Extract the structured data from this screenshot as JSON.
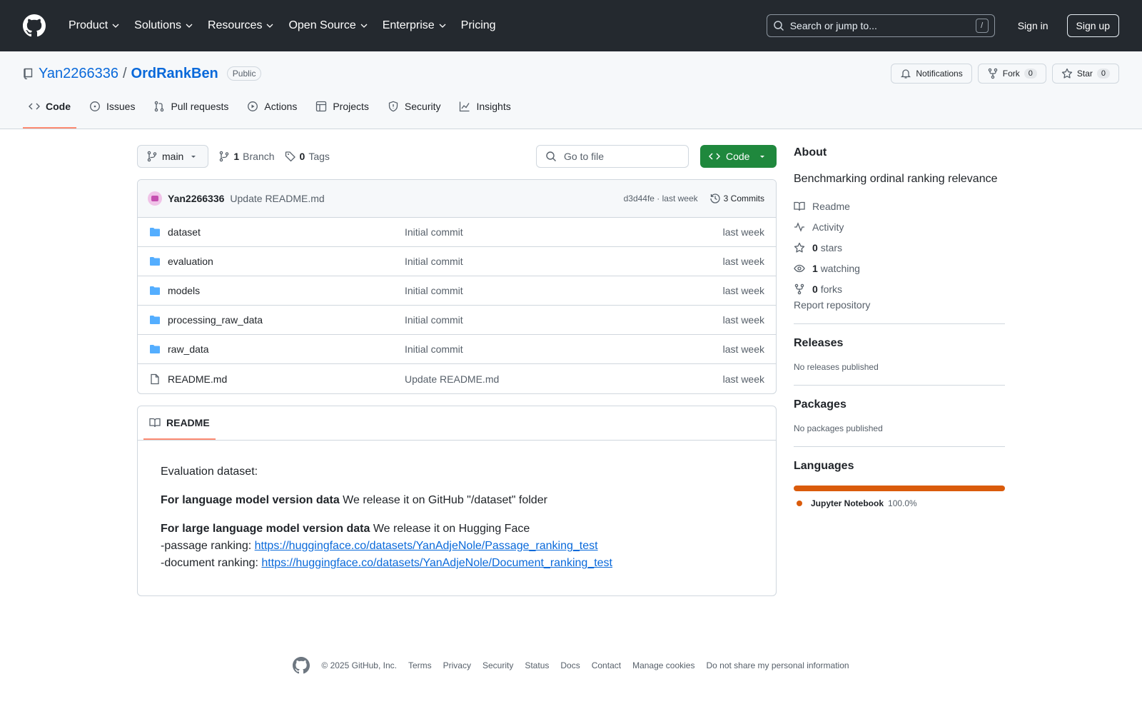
{
  "header": {
    "nav": [
      "Product",
      "Solutions",
      "Resources",
      "Open Source",
      "Enterprise",
      "Pricing"
    ],
    "search_placeholder": "Search or jump to...",
    "search_shortcut": "/",
    "sign_in": "Sign in",
    "sign_up": "Sign up"
  },
  "repo": {
    "owner": "Yan2266336",
    "separator": "/",
    "name": "OrdRankBen",
    "visibility": "Public",
    "notifications_label": "Notifications",
    "fork_label": "Fork",
    "fork_count": "0",
    "star_label": "Star",
    "star_count": "0"
  },
  "tabs": [
    {
      "label": "Code",
      "icon": "code-icon"
    },
    {
      "label": "Issues",
      "icon": "issue-icon"
    },
    {
      "label": "Pull requests",
      "icon": "pull-request-icon"
    },
    {
      "label": "Actions",
      "icon": "play-icon"
    },
    {
      "label": "Projects",
      "icon": "table-icon"
    },
    {
      "label": "Security",
      "icon": "shield-icon"
    },
    {
      "label": "Insights",
      "icon": "graph-icon"
    }
  ],
  "toolbar": {
    "branch": "main",
    "branch_count": "1",
    "branch_label": "Branch",
    "tag_count": "0",
    "tag_label": "Tags",
    "goto_placeholder": "Go to file",
    "code_label": "Code"
  },
  "commit": {
    "author": "Yan2266336",
    "message": "Update README.md",
    "hash_time": "d3d44fe · last week",
    "commits_label": "3 Commits"
  },
  "files": [
    {
      "name": "dataset",
      "type": "dir",
      "commit": "Initial commit",
      "time": "last week"
    },
    {
      "name": "evaluation",
      "type": "dir",
      "commit": "Initial commit",
      "time": "last week"
    },
    {
      "name": "models",
      "type": "dir",
      "commit": "Initial commit",
      "time": "last week"
    },
    {
      "name": "processing_raw_data",
      "type": "dir",
      "commit": "Initial commit",
      "time": "last week"
    },
    {
      "name": "raw_data",
      "type": "dir",
      "commit": "Initial commit",
      "time": "last week"
    },
    {
      "name": "README.md",
      "type": "file",
      "commit": "Update README.md",
      "time": "last week"
    }
  ],
  "readme": {
    "tab_label": "README",
    "line1": "Evaluation dataset:",
    "lm_bold": "For language model version data",
    "lm_text": " We release it on GitHub \"/dataset\" folder",
    "llm_bold": "For large language model version data",
    "llm_text": " We release it on Hugging Face",
    "passage_prefix": "-passage ranking: ",
    "passage_link": "https://huggingface.co/datasets/YanAdjeNole/Passage_ranking_test",
    "document_prefix": "-document ranking: ",
    "document_link": "https://huggingface.co/datasets/YanAdjeNole/Document_ranking_test"
  },
  "about": {
    "title": "About",
    "description": "Benchmarking ordinal ranking relevance",
    "readme": "Readme",
    "activity": "Activity",
    "stars_count": "0",
    "stars_label": "stars",
    "watching_count": "1",
    "watching_label": "watching",
    "forks_count": "0",
    "forks_label": "forks",
    "report": "Report repository"
  },
  "releases": {
    "title": "Releases",
    "text": "No releases published"
  },
  "packages": {
    "title": "Packages",
    "text": "No packages published"
  },
  "languages": {
    "title": "Languages",
    "name": "Jupyter Notebook",
    "percent": "100.0%",
    "color": "#da5b0b"
  },
  "footer": {
    "copyright": "© 2025 GitHub, Inc.",
    "links": [
      "Terms",
      "Privacy",
      "Security",
      "Status",
      "Docs",
      "Contact",
      "Manage cookies",
      "Do not share my personal information"
    ]
  }
}
